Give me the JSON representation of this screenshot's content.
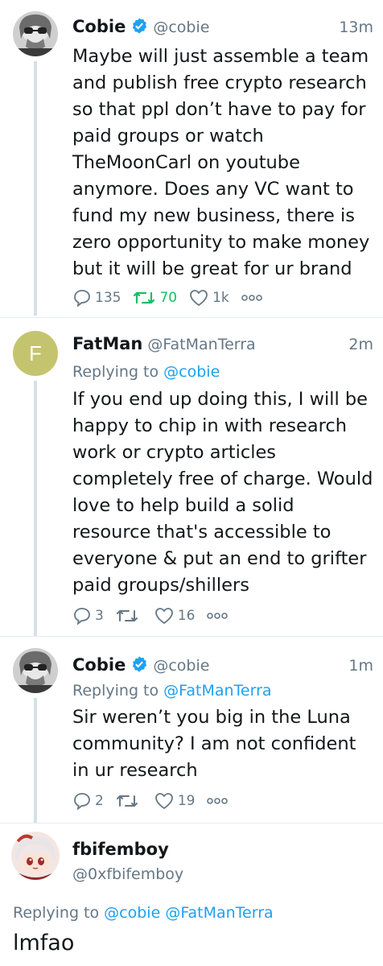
{
  "tweets": [
    {
      "name": "Cobie",
      "handle": "@cobie",
      "time": "13m",
      "lines": [
        "Maybe will just assemble a team",
        "and publish free crypto research",
        "so that ppl don’t have to pay for",
        "paid groups or watch",
        "TheMoonCarl on youtube",
        "anymore. Does any VC want to",
        "fund my new business, there is",
        "zero opportunity to make money",
        "but it will be great for ur brand"
      ],
      "replies": "135",
      "retweets": "70",
      "likes": "1k"
    },
    {
      "name": "FatMan",
      "handle": "@FatManTerra",
      "time": "2m",
      "avatar_letter": "F",
      "replying_label": "Replying to",
      "replying_to": "@cobie",
      "lines": [
        "If you end up doing this, I will be",
        "happy to chip in with research",
        "work or crypto articles",
        "completely free of charge. Would",
        "love to help build a solid",
        "resource that's accessible to",
        "everyone & put an end to grifter",
        "paid groups/shillers"
      ],
      "replies": "3",
      "retweets": "",
      "likes": "16"
    },
    {
      "name": "Cobie",
      "handle": "@cobie",
      "time": "1m",
      "replying_label": "Replying to",
      "replying_to": "@FatManTerra",
      "lines": [
        "Sir weren’t you big in the Luna",
        "community? I am not confident",
        "in ur research"
      ],
      "replies": "2",
      "retweets": "",
      "likes": "19"
    }
  ],
  "focused": {
    "name": "fbifemboy",
    "handle": "@0xfbifemboy",
    "replying_label": "Replying to",
    "replying_to_1": "@cobie",
    "replying_to_2": "@FatManTerra",
    "text": "lmfao"
  },
  "colors": {
    "link": "#1da1f2",
    "retweet_active": "#17bf63",
    "muted": "#657786",
    "thread_line": "#d6e0e7",
    "fatman_avatar": "#c5c46e"
  }
}
